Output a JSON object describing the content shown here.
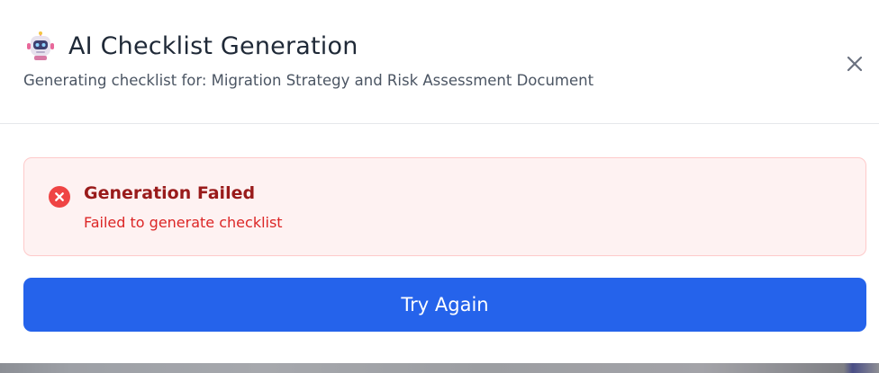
{
  "dialog": {
    "title": "AI Checklist Generation",
    "title_icon": "robot-icon",
    "subtitle": "Generating checklist for: Migration Strategy and Risk Assessment Document",
    "close_icon": "close-icon"
  },
  "error": {
    "icon": "x-circle-icon",
    "title": "Generation Failed",
    "message": "Failed to generate checklist"
  },
  "actions": {
    "retry_label": "Try Again"
  },
  "colors": {
    "primary": "#2563eb",
    "error_bg": "#fef2f2",
    "error_border": "#fecaca",
    "error_title": "#991b1b",
    "error_text": "#dc2626",
    "error_icon": "#ef4444"
  }
}
